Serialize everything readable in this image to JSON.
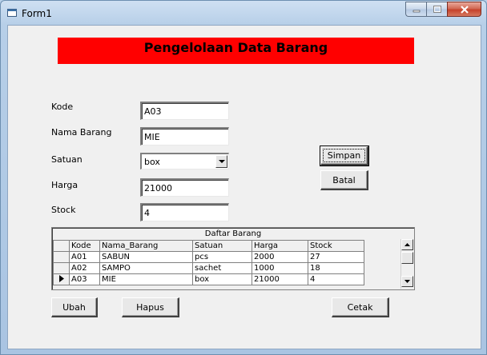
{
  "window": {
    "title": "Form1"
  },
  "header": {
    "title": "Pengelolaan Data Barang"
  },
  "form": {
    "kode_label": "Kode",
    "kode_value": "A03",
    "nama_label": "Nama Barang",
    "nama_value": "MIE",
    "satuan_label": "Satuan",
    "satuan_value": "box",
    "harga_label": "Harga",
    "harga_value": "21000",
    "stock_label": "Stock",
    "stock_value": "4"
  },
  "buttons": {
    "simpan": "Simpan",
    "batal": "Batal",
    "ubah": "Ubah",
    "hapus": "Hapus",
    "cetak": "Cetak"
  },
  "grid": {
    "caption": "Daftar Barang",
    "columns": [
      "Kode",
      "Nama_Barang",
      "Satuan",
      "Harga",
      "Stock"
    ],
    "rows": [
      [
        "A01",
        "SABUN",
        "pcs",
        "2000",
        "27"
      ],
      [
        "A02",
        "SAMPO",
        "sachet",
        "1000",
        "18"
      ],
      [
        "A03",
        "MIE",
        "box",
        "21000",
        "4"
      ]
    ],
    "selected_row_index": 2
  },
  "colors": {
    "banner": "#ff0000",
    "window_frame": "#b9d1ea",
    "client": "#f0f0f0"
  },
  "icons": {
    "window_icon": "form-icon",
    "minimize": "minimize-icon",
    "maximize": "maximize-icon",
    "close": "close-icon",
    "dropdown": "chevron-down-icon",
    "row_selector": "current-row-arrow-icon",
    "scroll_up": "scroll-up-icon",
    "scroll_down": "scroll-down-icon"
  }
}
